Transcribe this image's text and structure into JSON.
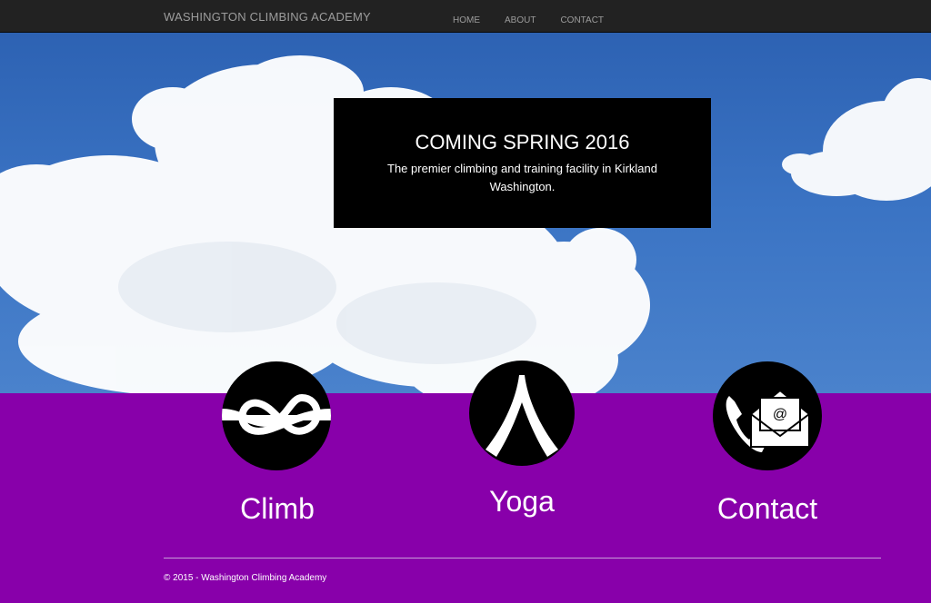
{
  "navbar": {
    "brand": "WASHINGTON CLIMBING ACADEMY",
    "links": [
      "HOME",
      "ABOUT",
      "CONTACT"
    ]
  },
  "banner": {
    "title": "COMING SPRING 2016",
    "subtitle": "The premier climbing and training facility in Kirkland Washington."
  },
  "features": [
    {
      "label": "Climb",
      "icon": "knot-icon"
    },
    {
      "label": "Yoga",
      "icon": "yoga-pose-icon"
    },
    {
      "label": "Contact",
      "icon": "phone-email-icon"
    }
  ],
  "footer": {
    "copyright": "© 2015 - Washington Climbing Academy"
  },
  "colors": {
    "navbar": "#222222",
    "sky": "#3b74c4",
    "purple": "#8800aa"
  }
}
